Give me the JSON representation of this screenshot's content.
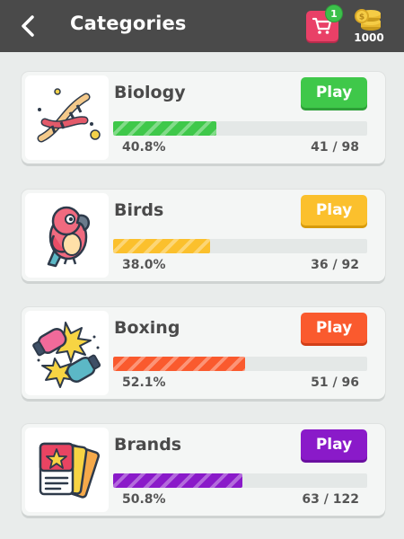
{
  "header": {
    "title": "Categories",
    "cart_badge": "1",
    "coins": "1000"
  },
  "categories": [
    {
      "name": "Biology",
      "play_label": "Play",
      "percent_text": "40.8%",
      "progress": 0.408,
      "count_text": "41 / 98",
      "color": "#3fc84a",
      "color_dark": "#2e9f38",
      "icon": "dna-icon"
    },
    {
      "name": "Birds",
      "play_label": "Play",
      "percent_text": "38.0%",
      "progress": 0.38,
      "count_text": "36 / 92",
      "color": "#fbc02d",
      "color_dark": "#d79b0c",
      "icon": "parrot-icon"
    },
    {
      "name": "Boxing",
      "play_label": "Play",
      "percent_text": "52.1%",
      "progress": 0.521,
      "count_text": "51 / 96",
      "color": "#fa5a2e",
      "color_dark": "#d23f18",
      "icon": "boxing-gloves-icon"
    },
    {
      "name": "Brands",
      "play_label": "Play",
      "percent_text": "50.8%",
      "progress": 0.508,
      "count_text": "63 / 122",
      "color": "#8a1ac9",
      "color_dark": "#6a0fa0",
      "icon": "brand-cards-icon"
    }
  ]
}
